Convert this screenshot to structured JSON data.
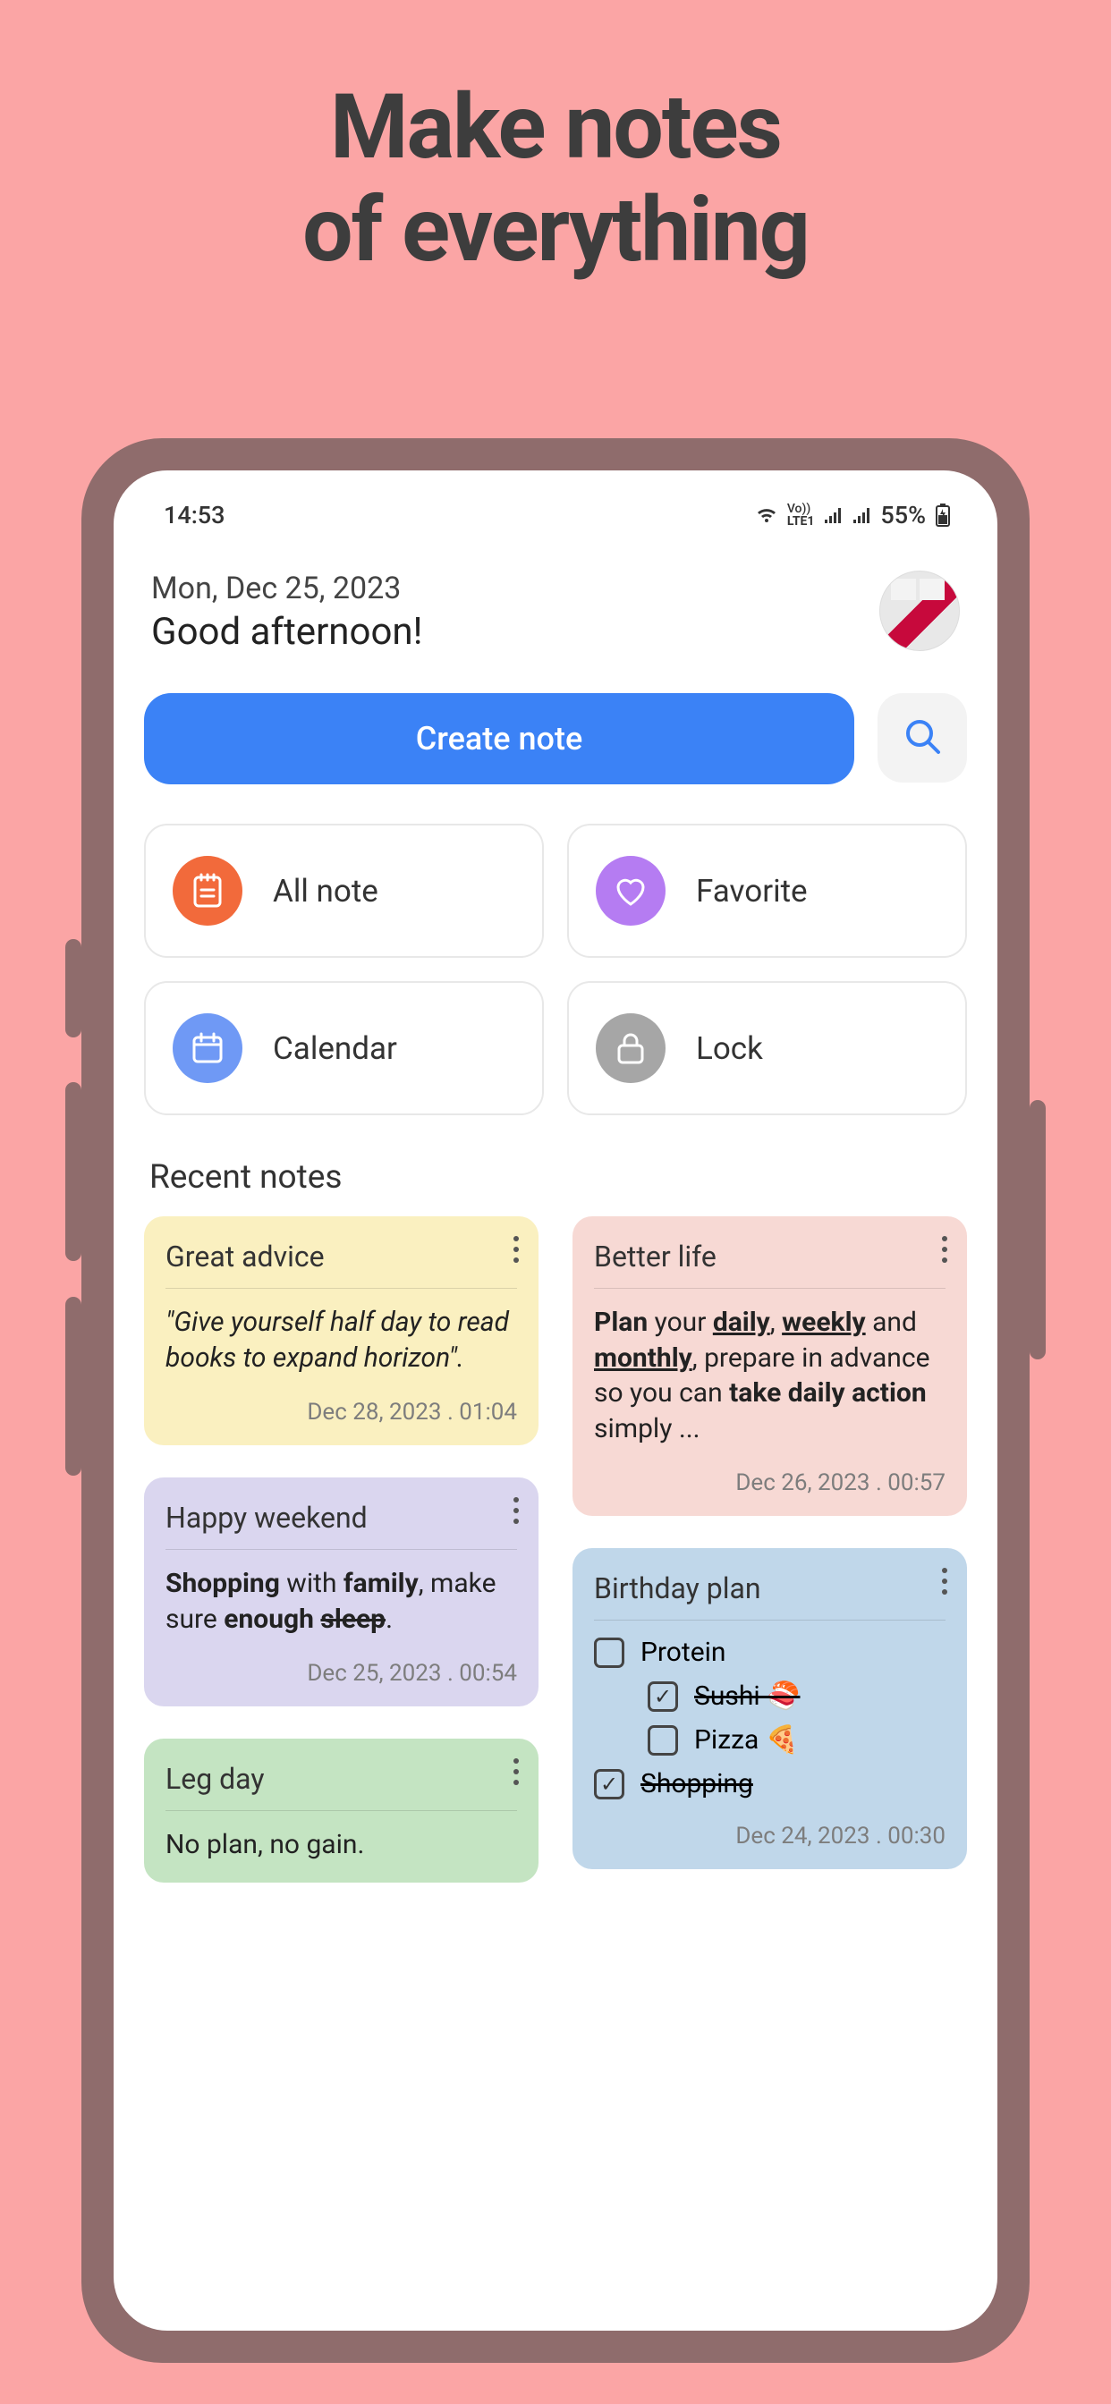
{
  "hero": {
    "line1": "Make notes",
    "line2": "of everything"
  },
  "status": {
    "time": "14:53",
    "net": "LTE1",
    "battery": "55%"
  },
  "header": {
    "date": "Mon, Dec 25, 2023",
    "greeting": "Good afternoon!"
  },
  "actions": {
    "create": "Create note"
  },
  "categories": {
    "all": {
      "label": "All note"
    },
    "favorite": {
      "label": "Favorite"
    },
    "calendar": {
      "label": "Calendar"
    },
    "lock": {
      "label": "Lock"
    }
  },
  "recent_heading": "Recent notes",
  "notes": {
    "advice": {
      "title": "Great advice",
      "body": "\"Give yourself half day to read books to expand horizon\".",
      "date": "Dec 28, 2023 . 01:04"
    },
    "better": {
      "title": "Better life",
      "date": "Dec 26, 2023 . 00:57",
      "rt": {
        "t1": "Plan",
        "t2": " your ",
        "t3": "daily",
        "t4": ", ",
        "t5": "weekly",
        "t6": " and ",
        "t7": "monthly",
        "t8": ", prepare in advance so you can ",
        "t9": "take daily action",
        "t10": " simply ..."
      }
    },
    "weekend": {
      "title": "Happy weekend",
      "date": "Dec 25, 2023 . 00:54",
      "rt": {
        "t1": "Shopping",
        "t2": " with ",
        "t3": "family",
        "t4": ", make sure ",
        "t5": "enough ",
        "t6": "sleep",
        "t7": "."
      }
    },
    "birthday": {
      "title": "Birthday plan",
      "date": "Dec 24, 2023 . 00:30",
      "items": {
        "protein": "Protein",
        "sushi": "Sushi 🍣",
        "pizza": "Pizza 🍕",
        "shopping": "Shopping"
      }
    },
    "leg": {
      "title": "Leg day",
      "body": "No plan, no gain."
    }
  }
}
